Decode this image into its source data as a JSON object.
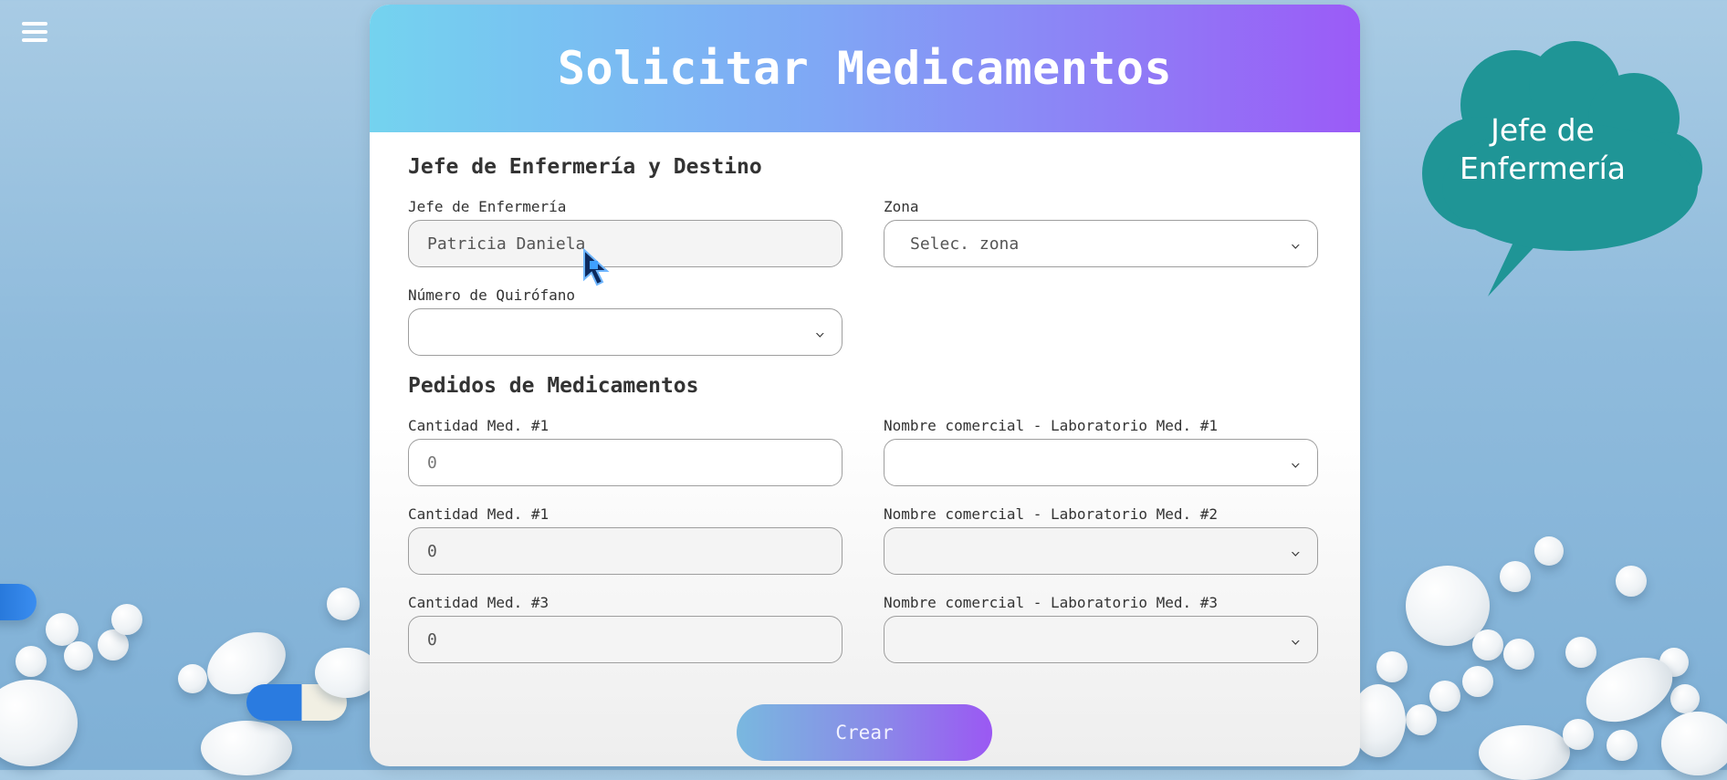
{
  "app": {
    "title": "Solicitar Medicamentos",
    "role_badge": "Jefe de Enfermería"
  },
  "colors": {
    "header_gradient_start": "#74d3ef",
    "header_gradient_end": "#9b5bf7",
    "cloud_badge": "#1f9596",
    "button_gradient_end": "#9b58f3"
  },
  "icons": {
    "menu": "hamburger-menu-icon",
    "dropdown": "chevron-down-icon",
    "cursor": "mouse-pointer-icon"
  },
  "section_destination": {
    "title": "Jefe de Enfermería y Destino",
    "head_nurse": {
      "label": "Jefe de Enfermería",
      "value": "Patricia Daniela"
    },
    "zone": {
      "label": "Zona",
      "selected": "Selec. zona"
    },
    "operating_room": {
      "label": "Número de Quirófano",
      "selected": ""
    }
  },
  "section_orders": {
    "title": "Pedidos de Medicamentos",
    "rows": [
      {
        "qty_label": "Cantidad Med. #1",
        "qty_value": "0",
        "name_label": "Nombre comercial - Laboratorio Med. #1",
        "name_selected": ""
      },
      {
        "qty_label": "Cantidad Med. #1",
        "qty_value": "0",
        "name_label": "Nombre comercial - Laboratorio Med. #2",
        "name_selected": ""
      },
      {
        "qty_label": "Cantidad Med. #3",
        "qty_value": "0",
        "name_label": "Nombre comercial - Laboratorio Med. #3",
        "name_selected": ""
      }
    ]
  },
  "actions": {
    "create_label": "Crear"
  }
}
